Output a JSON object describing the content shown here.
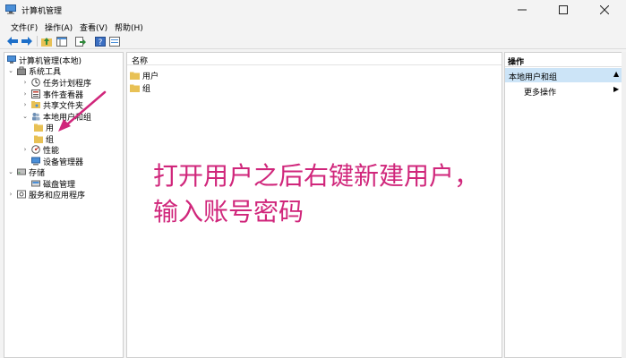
{
  "window": {
    "title": "计算机管理"
  },
  "menu": [
    "文件(F)",
    "操作(A)",
    "查看(V)",
    "帮助(H)"
  ],
  "tree": {
    "root": "计算机管理(本地)",
    "system_tools": "系统工具",
    "task_scheduler": "任务计划程序",
    "event_viewer": "事件查看器",
    "shared_folders": "共享文件夹",
    "local_users_groups": "本地用户和组",
    "users_partial": "用",
    "groups": "组",
    "performance": "性能",
    "device_manager": "设备管理器",
    "storage": "存储",
    "disk_management": "磁盘管理",
    "services_apps": "服务和应用程序"
  },
  "center": {
    "column_name": "名称",
    "items": [
      "用户",
      "组"
    ],
    "annotation_line1": "打开用户之后右键新建用户，",
    "annotation_line2": "输入账号密码"
  },
  "actions": {
    "header": "操作",
    "section": "本地用户和组",
    "more": "更多操作"
  },
  "colors": {
    "annotation": "#d0267b",
    "selection": "#cce4f7",
    "folder": "#e8c155"
  }
}
